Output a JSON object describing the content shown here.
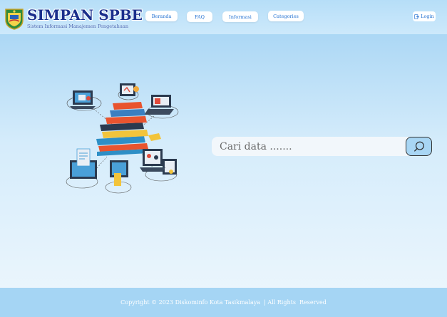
{
  "header": {
    "title": "SIMPAN SPBE",
    "subtitle": "Sistem Informasi Manajemen Pengetahuan",
    "logo_icon": "kota-tasikmalaya-emblem-icon"
  },
  "nav": {
    "items": [
      {
        "label": "Beranda"
      },
      {
        "label": "FAQ"
      },
      {
        "label": "Informasi"
      },
      {
        "label": "Categories"
      }
    ],
    "login_label": "Login",
    "login_icon": "login-icon"
  },
  "hero": {
    "illustration": "books-and-devices-illustration"
  },
  "search": {
    "placeholder": "Cari data .......",
    "button_icon": "search-icon"
  },
  "footer": {
    "text": "Copyright © 2023 Diskominfo Kota Tasikmalaya  | All Rights  Reserved"
  },
  "colors": {
    "header_bg": "#b6def8",
    "footer_bg": "#a5d5f4",
    "brand_text": "#1a2f8c",
    "accent": "#1f6fd1"
  }
}
